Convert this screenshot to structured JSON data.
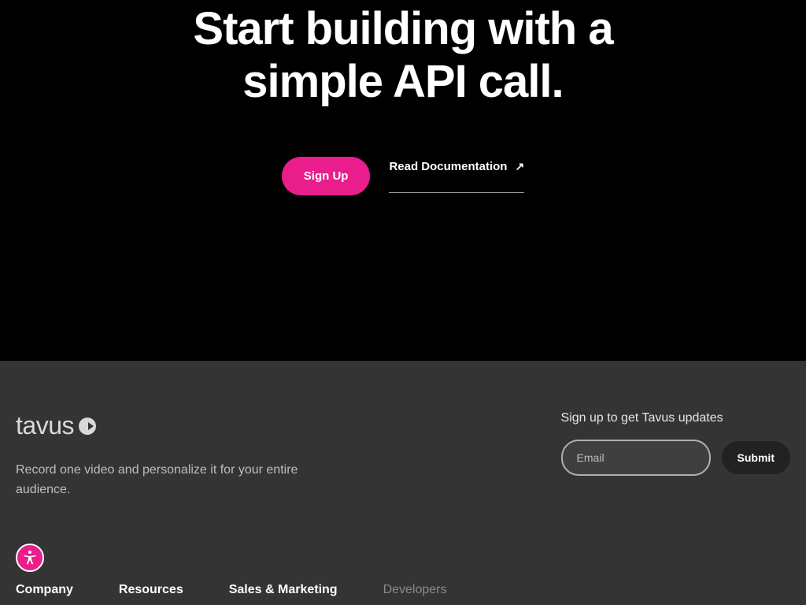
{
  "hero": {
    "heading_line1": "Start building with a",
    "heading_line2": "simple API call.",
    "signup_label": "Sign Up",
    "docs_label": "Read Documentation",
    "arrow_glyph": "↗"
  },
  "footer": {
    "logo_text": "tavus",
    "tagline": "Record one video and personalize it for your entire audience.",
    "newsletter_label": "Sign up to get Tavus updates",
    "email_placeholder": "Email",
    "submit_label": "Submit",
    "nav": {
      "company": "Company",
      "resources": "Resources",
      "sales_marketing": "Sales & Marketing",
      "developers": "Developers"
    }
  }
}
